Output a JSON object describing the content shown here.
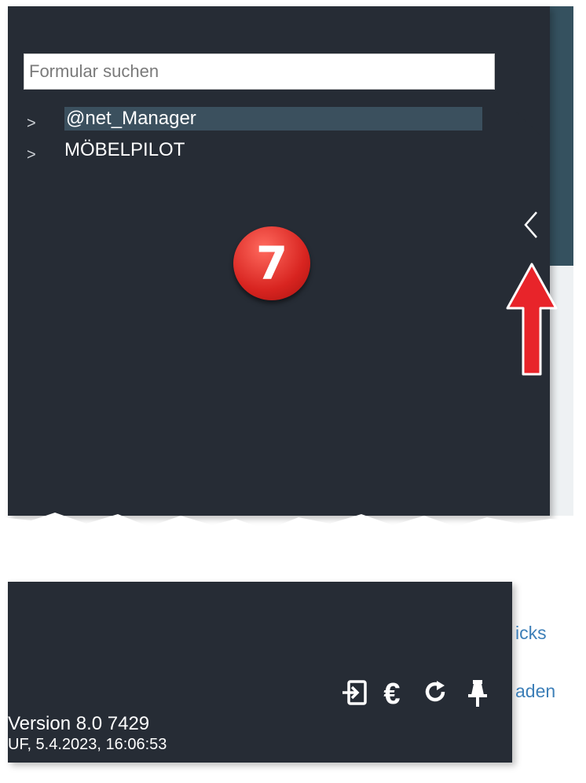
{
  "search": {
    "placeholder": "Formular suchen"
  },
  "tree": {
    "items": [
      {
        "label": "@net_Manager",
        "selected": true,
        "icon": "chevron-right-icon"
      },
      {
        "label": "MÖBELPILOT",
        "selected": false,
        "icon": "chevron-right-icon"
      }
    ]
  },
  "collapse_button": {
    "icon": "chevron-left-icon",
    "glyph": "‹"
  },
  "annotation": {
    "step_number": "7",
    "color": "#d82420"
  },
  "app_links": {
    "partial_link_1": "icks",
    "partial_link_2": "aden"
  },
  "toolbar": {
    "icons": [
      "sign-in-icon",
      "euro-icon",
      "refresh-icon",
      "pin-icon"
    ]
  },
  "footer": {
    "version": "Version 8.0 7429",
    "build": "UF, 5.4.2023, 16:06:53"
  },
  "colors": {
    "panel_bg": "#262c35",
    "selected_bg": "#3b505e",
    "app_header": "#35515f",
    "link": "#3d7fb8",
    "arrow": "#e8242a"
  }
}
